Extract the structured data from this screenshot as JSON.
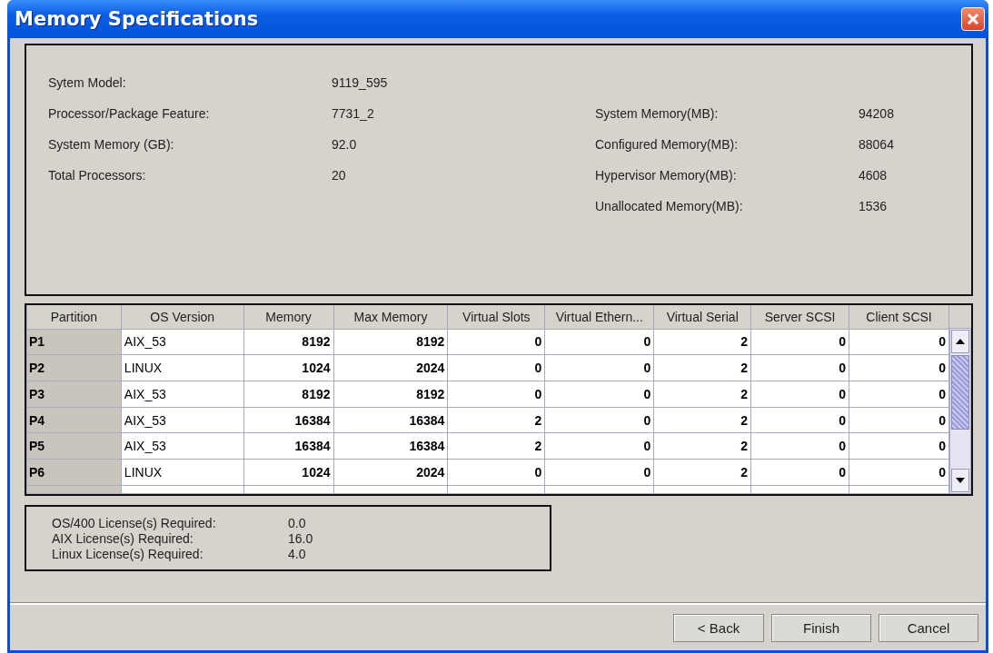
{
  "window": {
    "title": "Memory Specifications"
  },
  "system_info": {
    "left": [
      {
        "label": "Sytem Model:",
        "value": "9119_595"
      },
      {
        "label": "Processor/Package Feature:",
        "value": "7731_2"
      },
      {
        "label": "System Memory (GB):",
        "value": "92.0"
      },
      {
        "label": "Total Processors:",
        "value": "20"
      }
    ],
    "right": [
      {
        "label": "System Memory(MB):",
        "value": "94208"
      },
      {
        "label": "Configured Memory(MB):",
        "value": "88064"
      },
      {
        "label": "Hypervisor Memory(MB):",
        "value": "4608"
      },
      {
        "label": "Unallocated Memory(MB):",
        "value": "1536"
      }
    ]
  },
  "table": {
    "columns": [
      "Partition",
      "OS Version",
      "Memory",
      "Max Memory",
      "Virtual Slots",
      "Virtual Ethern...",
      "Virtual Serial",
      "Server SCSI",
      "Client SCSI"
    ],
    "rows": [
      [
        "P1",
        "AIX_53",
        "8192",
        "8192",
        "0",
        "0",
        "2",
        "0",
        "0"
      ],
      [
        "P2",
        "LINUX",
        "1024",
        "2024",
        "0",
        "0",
        "2",
        "0",
        "0"
      ],
      [
        "P3",
        "AIX_53",
        "8192",
        "8192",
        "0",
        "0",
        "2",
        "0",
        "0"
      ],
      [
        "P4",
        "AIX_53",
        "16384",
        "16384",
        "2",
        "0",
        "2",
        "0",
        "0"
      ],
      [
        "P5",
        "AIX_53",
        "16384",
        "16384",
        "2",
        "0",
        "2",
        "0",
        "0"
      ],
      [
        "P6",
        "LINUX",
        "1024",
        "2024",
        "0",
        "0",
        "2",
        "0",
        "0"
      ]
    ]
  },
  "licenses": [
    {
      "label": "OS/400 License(s) Required:",
      "value": "0.0"
    },
    {
      "label": "AIX License(s) Required:",
      "value": "16.0"
    },
    {
      "label": "Linux License(s) Required:",
      "value": "4.0"
    }
  ],
  "buttons": [
    "< Back",
    "Finish",
    "Cancel"
  ]
}
